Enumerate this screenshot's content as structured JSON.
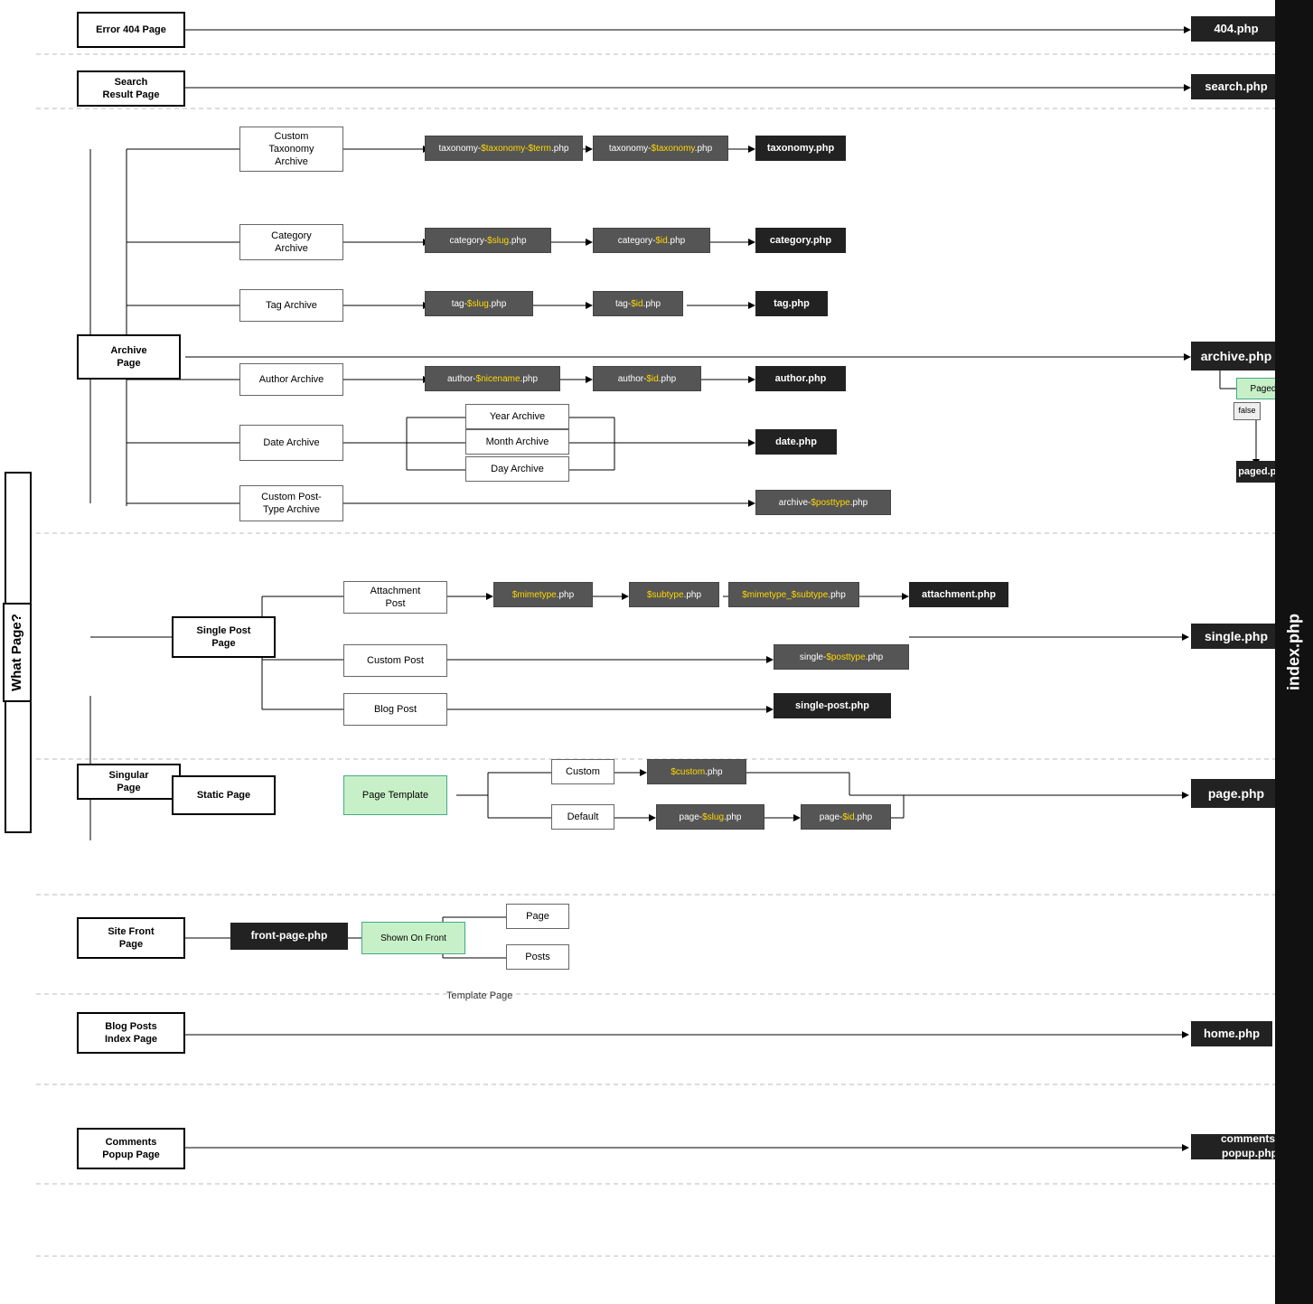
{
  "title": "What Page?",
  "index_label": "index.php",
  "sections": {
    "error404": {
      "label": "Error 404\nPage",
      "php": "404.php"
    },
    "search": {
      "label": "Search\nResult Page",
      "php": "search.php"
    },
    "archive": {
      "label": "Archive\nPage",
      "php": "archive.php",
      "children": {
        "customTaxonomy": {
          "label": "Custom\nTaxonomy\nArchive",
          "files": [
            "taxonomy-$taxonomy-$term.php",
            "taxonomy-$taxonomy.php",
            "taxonomy.php"
          ]
        },
        "category": {
          "label": "Category\nArchive",
          "files": [
            "category-$slug.php",
            "category-$id.php",
            "category.php"
          ]
        },
        "tag": {
          "label": "Tag Archive",
          "files": [
            "tag-$slug.php",
            "tag-$id.php",
            "tag.php"
          ]
        },
        "author": {
          "label": "Author Archive",
          "files": [
            "author-$nicename.php",
            "author-$id.php",
            "author.php"
          ]
        },
        "date": {
          "label": "Date Archive",
          "sub": [
            "Year Archive",
            "Month Archive",
            "Day Archive"
          ],
          "php": "date.php"
        },
        "customPostType": {
          "label": "Custom Post-\nType Archive",
          "files": [
            "archive-$posttype.php"
          ]
        }
      }
    },
    "paged": {
      "label": "Paged",
      "true_label": "true",
      "false_label": "false",
      "php": "paged.php"
    },
    "singular": {
      "label": "Singular\nPage",
      "singlePost": {
        "label": "Single Post\nPage",
        "php": "single.php",
        "children": {
          "attachment": {
            "label": "Attachment\nPost",
            "files": [
              "$mimetype.php",
              "$subtype.php",
              "$mimetype_$subtype.php",
              "attachment.php"
            ]
          },
          "customPost": {
            "label": "Custom Post",
            "files": [
              "single-$posttype.php"
            ]
          },
          "blogPost": {
            "label": "Blog Post",
            "files": [
              "single-post.php"
            ]
          }
        }
      },
      "staticPage": {
        "label": "Static Page",
        "php": "page.php",
        "pageTemplate": {
          "label": "Page Template",
          "custom": {
            "label": "Custom",
            "file": "$custom.php"
          },
          "default": {
            "label": "Default",
            "files": [
              "page-$slug.php",
              "page-$id.php"
            ]
          }
        }
      }
    },
    "siteFront": {
      "label": "Site Front\nPage",
      "php": "front-page.php",
      "shownOnFront": "Shown On Front",
      "options": [
        "Page",
        "Posts"
      ]
    },
    "blogPostsIndex": {
      "label": "Blog Posts\nIndex Page",
      "php": "home.php"
    },
    "commentsPopup": {
      "label": "Comments\nPopup Page",
      "php": "comments-popup.php"
    }
  }
}
